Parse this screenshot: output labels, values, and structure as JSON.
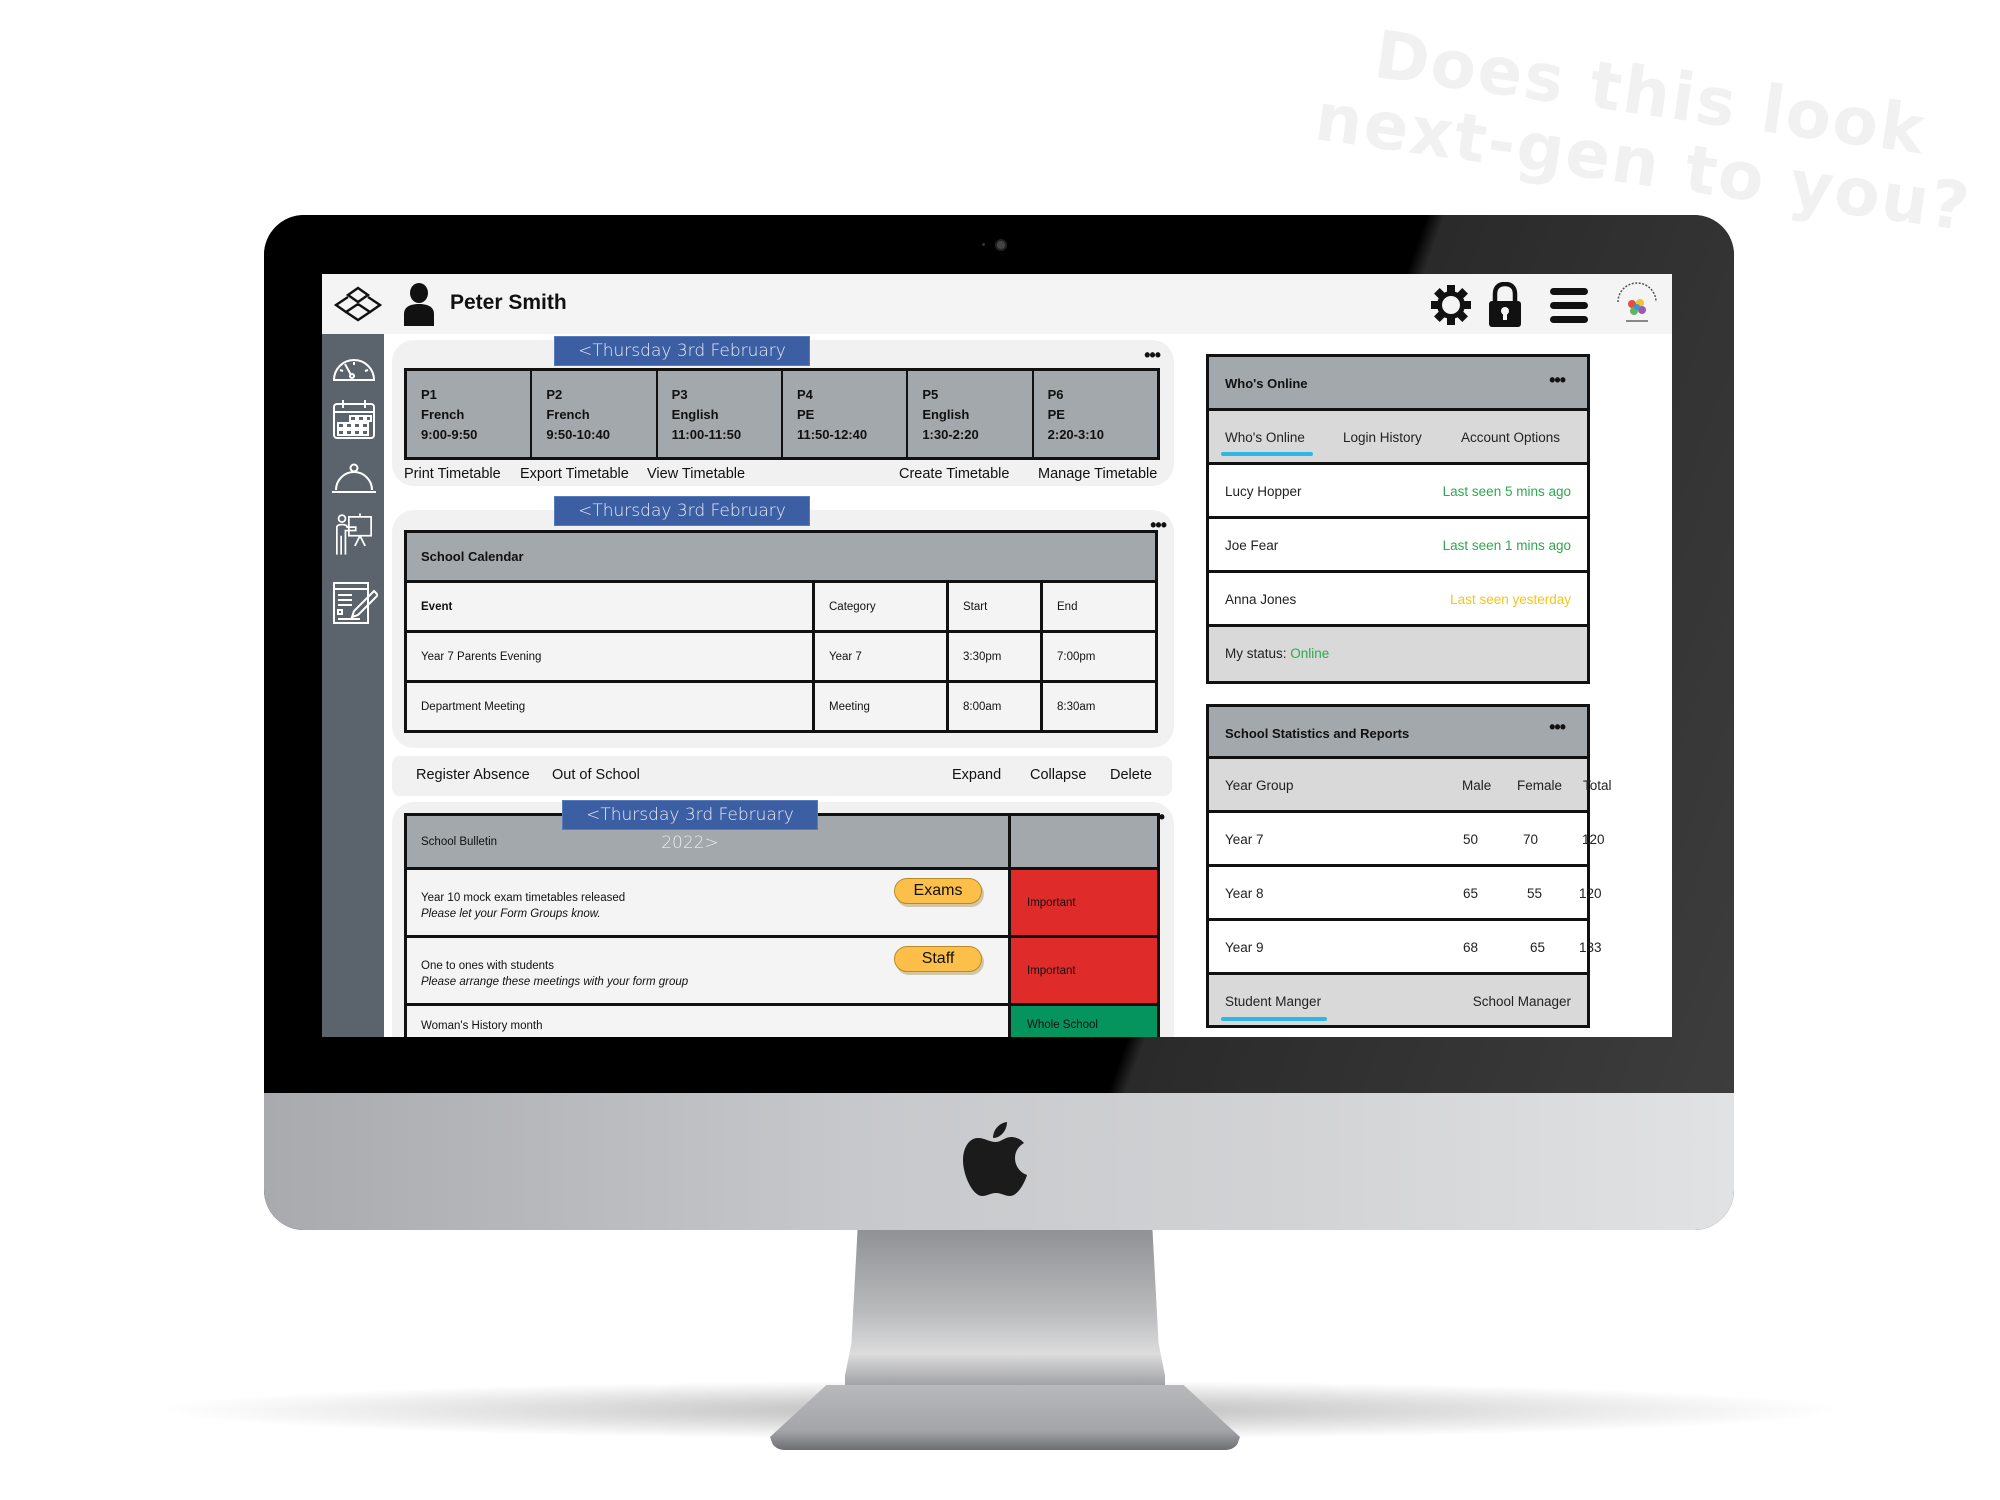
{
  "watermark": {
    "line1": "Does this look",
    "line2": "next-gen to you?"
  },
  "header": {
    "user_name": "Peter Smith",
    "icons": [
      "layers-logo-icon",
      "user-icon",
      "gear-icon",
      "lock-icon",
      "menu-icon",
      "school-logo"
    ]
  },
  "sidebar": {
    "items": [
      "dashboard-gauge-icon",
      "calendar-icon",
      "dining-cloche-icon",
      "teacher-presentation-icon",
      "report-edit-icon"
    ]
  },
  "date_label": "<Thursday 3rd February 2022>",
  "timetable": {
    "periods": [
      {
        "period": "P1",
        "subject": "French",
        "time": "9:00-9:50"
      },
      {
        "period": "P2",
        "subject": "French",
        "time": "9:50-10:40"
      },
      {
        "period": "P3",
        "subject": "English",
        "time": "11:00-11:50"
      },
      {
        "period": "P4",
        "subject": "PE",
        "time": "11:50-12:40"
      },
      {
        "period": "P5",
        "subject": "English",
        "time": "1:30-2:20"
      },
      {
        "period": "P6",
        "subject": "PE",
        "time": "2:20-3:10"
      }
    ],
    "actions": [
      "Print Timetable",
      "Export Timetable",
      "View Timetable",
      "Create Timetable",
      "Manage Timetable"
    ]
  },
  "calendar": {
    "title": "School Calendar",
    "columns": [
      "Event",
      "Category",
      "Start",
      "End"
    ],
    "rows": [
      [
        "Year 7 Parents Evening",
        "Year 7",
        "3:30pm",
        "7:00pm"
      ],
      [
        "Department Meeting",
        "Meeting",
        "8:00am",
        "8:30am"
      ]
    ]
  },
  "action_strip": {
    "left": [
      "Register Absence",
      "Out of School"
    ],
    "right": [
      "Expand",
      "Collapse",
      "Delete"
    ]
  },
  "bulletin": {
    "title": "School Bulletin",
    "items": [
      {
        "title": "Year 10 mock exam timetables released",
        "note": "Please let your Form Groups know.",
        "tag": "Exams",
        "priority": "Important",
        "color": "#e02b2b"
      },
      {
        "title": "One to ones with students",
        "note": "Please arrange these meetings with your form group",
        "tag": "Staff",
        "priority": "Important",
        "color": "#e02b2b"
      },
      {
        "title": "Woman's History month",
        "note": "",
        "tag": "",
        "priority": "Whole School",
        "color": "#05945e"
      }
    ]
  },
  "whos_online": {
    "title": "Who's Online",
    "tabs": [
      "Who's Online",
      "Login History",
      "Account Options"
    ],
    "active_tab": "Who's Online",
    "users": [
      {
        "name": "Lucy Hopper",
        "status": "Last seen 5 mins ago",
        "color": "#2fa84f"
      },
      {
        "name": "Joe Fear",
        "status": "Last seen 1 mins ago",
        "color": "#2fa84f"
      },
      {
        "name": "Anna Jones",
        "status": "Last seen yesterday",
        "color": "#f5c518"
      }
    ],
    "my_status_label": "My status:",
    "my_status": "Online"
  },
  "stats": {
    "title": "School Statistics and Reports",
    "columns": [
      "Year Group",
      "Male",
      "Female",
      "Total"
    ],
    "rows": [
      [
        "Year 7",
        "50",
        "70",
        "120"
      ],
      [
        "Year 8",
        "65",
        "55",
        "120"
      ],
      [
        "Year 9",
        "68",
        "65",
        "133"
      ]
    ],
    "footer_tabs": [
      "Student Manger",
      "School Manager"
    ],
    "active_footer_tab": "Student Manger"
  },
  "more_label": "•••",
  "colors": {
    "accent_blue": "#3c5fa3",
    "sidebar": "#5b646c",
    "header_gray": "#a2a8ab",
    "tab_underline": "#2fb6e3",
    "tag_yellow": "#fcbf49"
  }
}
